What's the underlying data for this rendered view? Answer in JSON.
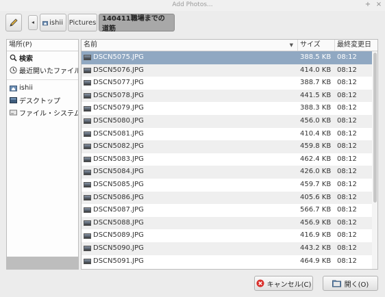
{
  "window": {
    "title": "Add Photos..."
  },
  "breadcrumb": {
    "home": "ishii",
    "folder": "Pictures",
    "current": "140411職場までの道筋"
  },
  "places": {
    "header": "場所(P)",
    "items": [
      {
        "label": "検索",
        "icon": "search-icon",
        "bold": true
      },
      {
        "label": "最近開いたファイル",
        "icon": "recent-clock-icon",
        "bold": false
      },
      {
        "label": "ishii",
        "icon": "home-folder-icon",
        "bold": false
      },
      {
        "label": "デスクトップ",
        "icon": "desktop-icon",
        "bold": false
      },
      {
        "label": "ファイル・システム",
        "icon": "filesystem-drive-icon",
        "bold": false
      }
    ]
  },
  "files": {
    "columns": {
      "name": "名前",
      "size": "サイズ",
      "modified": "最終変更日"
    },
    "rows": [
      {
        "name": "DSCN5075.JPG",
        "size": "388.5 KB",
        "modified": "08:12",
        "selected": true
      },
      {
        "name": "DSCN5076.JPG",
        "size": "414.0 KB",
        "modified": "08:12"
      },
      {
        "name": "DSCN5077.JPG",
        "size": "388.7 KB",
        "modified": "08:12"
      },
      {
        "name": "DSCN5078.JPG",
        "size": "441.5 KB",
        "modified": "08:12"
      },
      {
        "name": "DSCN5079.JPG",
        "size": "388.3 KB",
        "modified": "08:12"
      },
      {
        "name": "DSCN5080.JPG",
        "size": "456.0 KB",
        "modified": "08:12"
      },
      {
        "name": "DSCN5081.JPG",
        "size": "410.4 KB",
        "modified": "08:12"
      },
      {
        "name": "DSCN5082.JPG",
        "size": "459.8 KB",
        "modified": "08:12"
      },
      {
        "name": "DSCN5083.JPG",
        "size": "462.4 KB",
        "modified": "08:12"
      },
      {
        "name": "DSCN5084.JPG",
        "size": "426.0 KB",
        "modified": "08:12"
      },
      {
        "name": "DSCN5085.JPG",
        "size": "459.7 KB",
        "modified": "08:12"
      },
      {
        "name": "DSCN5086.JPG",
        "size": "405.6 KB",
        "modified": "08:12"
      },
      {
        "name": "DSCN5087.JPG",
        "size": "566.7 KB",
        "modified": "08:12"
      },
      {
        "name": "DSCN5088.JPG",
        "size": "456.9 KB",
        "modified": "08:12"
      },
      {
        "name": "DSCN5089.JPG",
        "size": "416.9 KB",
        "modified": "08:12"
      },
      {
        "name": "DSCN5090.JPG",
        "size": "443.2 KB",
        "modified": "08:12"
      },
      {
        "name": "DSCN5091.JPG",
        "size": "464.9 KB",
        "modified": "08:12"
      }
    ]
  },
  "buttons": {
    "cancel": "キャンセル(C)",
    "open": "開く(O)"
  },
  "colors": {
    "selection": "#90a8c2",
    "current_crumb": "#a8a8a8",
    "cancel_icon": "#d9302c"
  }
}
